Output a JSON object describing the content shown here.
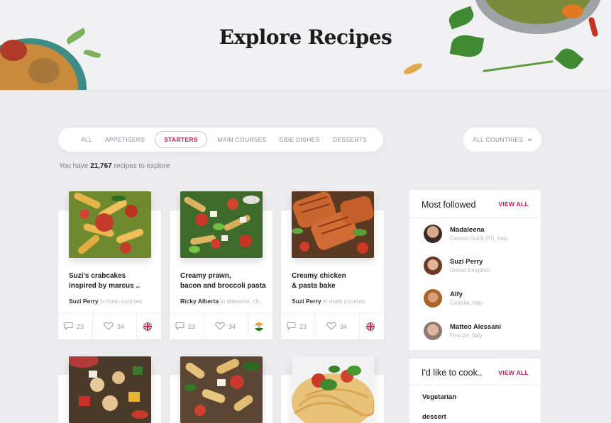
{
  "header": {
    "title": "Explore Recipes"
  },
  "filters": {
    "tabs": [
      {
        "label": "ALL"
      },
      {
        "label": "APPETISERS"
      },
      {
        "label": "STARTERS"
      },
      {
        "label": "MAIN COURSES"
      },
      {
        "label": "SIDE DISHES"
      },
      {
        "label": "DESSERTS"
      }
    ],
    "active_tab": "STARTERS",
    "country_label": "ALL COUNTRIES",
    "country_chevron": "chevron-down-icon"
  },
  "summary": {
    "prefix": "You have",
    "count": "21,767",
    "suffix": "recipes to explore"
  },
  "recipes": [
    {
      "title_line1": "Suzi's crabcakes",
      "title_line2": "inspired by marcus ..",
      "author": "Suzi Perry",
      "category": "in main courses",
      "comments": "23",
      "likes": "34",
      "flag": "uk-flag-icon"
    },
    {
      "title_line1": "Creamy prawn,",
      "title_line2": "bacon and broccoli pasta",
      "author": "Ricky Alberta",
      "category": "in desserts, ch..",
      "comments": "23",
      "likes": "34",
      "flag": "india-flag-icon"
    },
    {
      "title_line1": "Creamy chicken",
      "title_line2": "& pasta bake",
      "author": "Suzi Perry",
      "category": "in main courses",
      "comments": "23",
      "likes": "34",
      "flag": "uk-flag-icon"
    }
  ],
  "most_followed": {
    "title": "Most followed",
    "view_all": "VIEW ALL",
    "people": [
      {
        "name": "Madaleena",
        "location": "Cerreto Guidi (FI), Italy"
      },
      {
        "name": "Suzi Perry",
        "location": "United Kingdom"
      },
      {
        "name": "Alfy",
        "location": "Catania, Italy"
      },
      {
        "name": "Matteo Alessani",
        "location": "Firenze, Italy"
      }
    ]
  },
  "cook_panel": {
    "title": "I'd like to cook..",
    "view_all": "VIEW ALL",
    "items": [
      "Vegetarian",
      "dessert"
    ]
  },
  "colors": {
    "accent": "#d3135a",
    "background": "#ececef",
    "card": "#ffffff"
  }
}
